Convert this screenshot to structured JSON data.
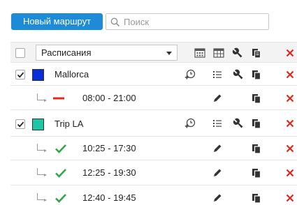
{
  "toolbar": {
    "new_route_label": "Новый маршрут",
    "search_placeholder": "Поиск"
  },
  "header": {
    "filter_value": "Расписания"
  },
  "routes": [
    {
      "name": "Mallorca",
      "color": "#0a2fd8",
      "checked": true,
      "trips": [
        {
          "time": "08:00 - 21:00",
          "status": "inactive"
        }
      ]
    },
    {
      "name": "Trip LA",
      "color": "#1fc6a5",
      "checked": true,
      "trips": [
        {
          "time": "10:25 - 17:30",
          "status": "active"
        },
        {
          "time": "12:25 - 19:30",
          "status": "active"
        },
        {
          "time": "12:40 - 19:45",
          "status": "active"
        }
      ]
    }
  ],
  "colors": {
    "accent": "#1d8bd8",
    "delete": "#e0281e",
    "active": "#2ea84a",
    "inactive": "#e0281e"
  },
  "icons": {
    "header": [
      "calendar-grid-icon",
      "table-icon",
      "wrench-icon",
      "copy-icon",
      "delete-icon"
    ],
    "route": [
      "add-schedule-icon",
      "list-icon",
      "wrench-icon",
      "copy-icon",
      "delete-icon"
    ],
    "trip": [
      "edit-icon",
      "copy-icon",
      "delete-icon"
    ]
  }
}
